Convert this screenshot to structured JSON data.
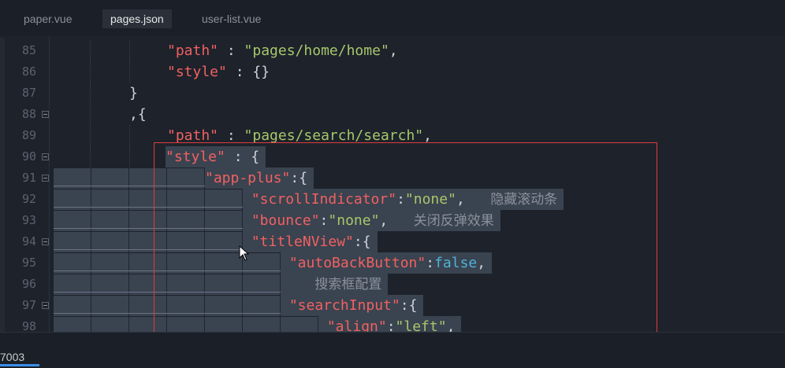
{
  "tabs": [
    {
      "label": "paper.vue"
    },
    {
      "label": "pages.json"
    },
    {
      "label": "user-list.vue"
    }
  ],
  "lines": [
    {
      "num": "85",
      "k1": "\"path\"",
      "p1": " : ",
      "s1": "\"pages/home/home\"",
      "p2": ","
    },
    {
      "num": "86",
      "k1": "\"style\"",
      "p1": " : {}"
    },
    {
      "num": "87",
      "p1": "}"
    },
    {
      "num": "88",
      "p1": ",{"
    },
    {
      "num": "89",
      "k1": "\"path\"",
      "p1": " : ",
      "s1": "\"pages/search/search\"",
      "p2": ","
    },
    {
      "num": "90",
      "k1": "\"style\"",
      "p1": " : {"
    },
    {
      "num": "91",
      "k1": "\"app-plus\"",
      "p1": ":{"
    },
    {
      "num": "92",
      "k1": "\"scrollIndicator\"",
      "p1": ":",
      "s1": "\"none\"",
      "p2": ",",
      "c1": "隐藏滚动条"
    },
    {
      "num": "93",
      "k1": "\"bounce\"",
      "p1": ":",
      "s1": "\"none\"",
      "p2": ",",
      "c1": "关闭反弹效果"
    },
    {
      "num": "94",
      "k1": "\"titleNView\"",
      "p1": ":{"
    },
    {
      "num": "95",
      "k1": "\"autoBackButton\"",
      "p1": ":",
      "b1": "false",
      "p2": ","
    },
    {
      "num": "96",
      "c1": "搜索框配置"
    },
    {
      "num": "97",
      "k1": "\"searchInput\"",
      "p1": ":{"
    },
    {
      "num": "98",
      "k1": "\"align\"",
      "p1": ":",
      "s1": "\"left\"",
      "p2": ","
    }
  ],
  "bottom_panel": {
    "tab_label": "7003"
  },
  "colors": {
    "keyword": "#f16161",
    "string": "#a7c76a",
    "boolean": "#4fb3d9",
    "comment": "#8b919b",
    "highlight_box": "#e03c3c",
    "selection": "#3a4350"
  },
  "icons": {
    "fold": "fold-minus-icon",
    "pointer": "mouse-pointer-icon"
  }
}
